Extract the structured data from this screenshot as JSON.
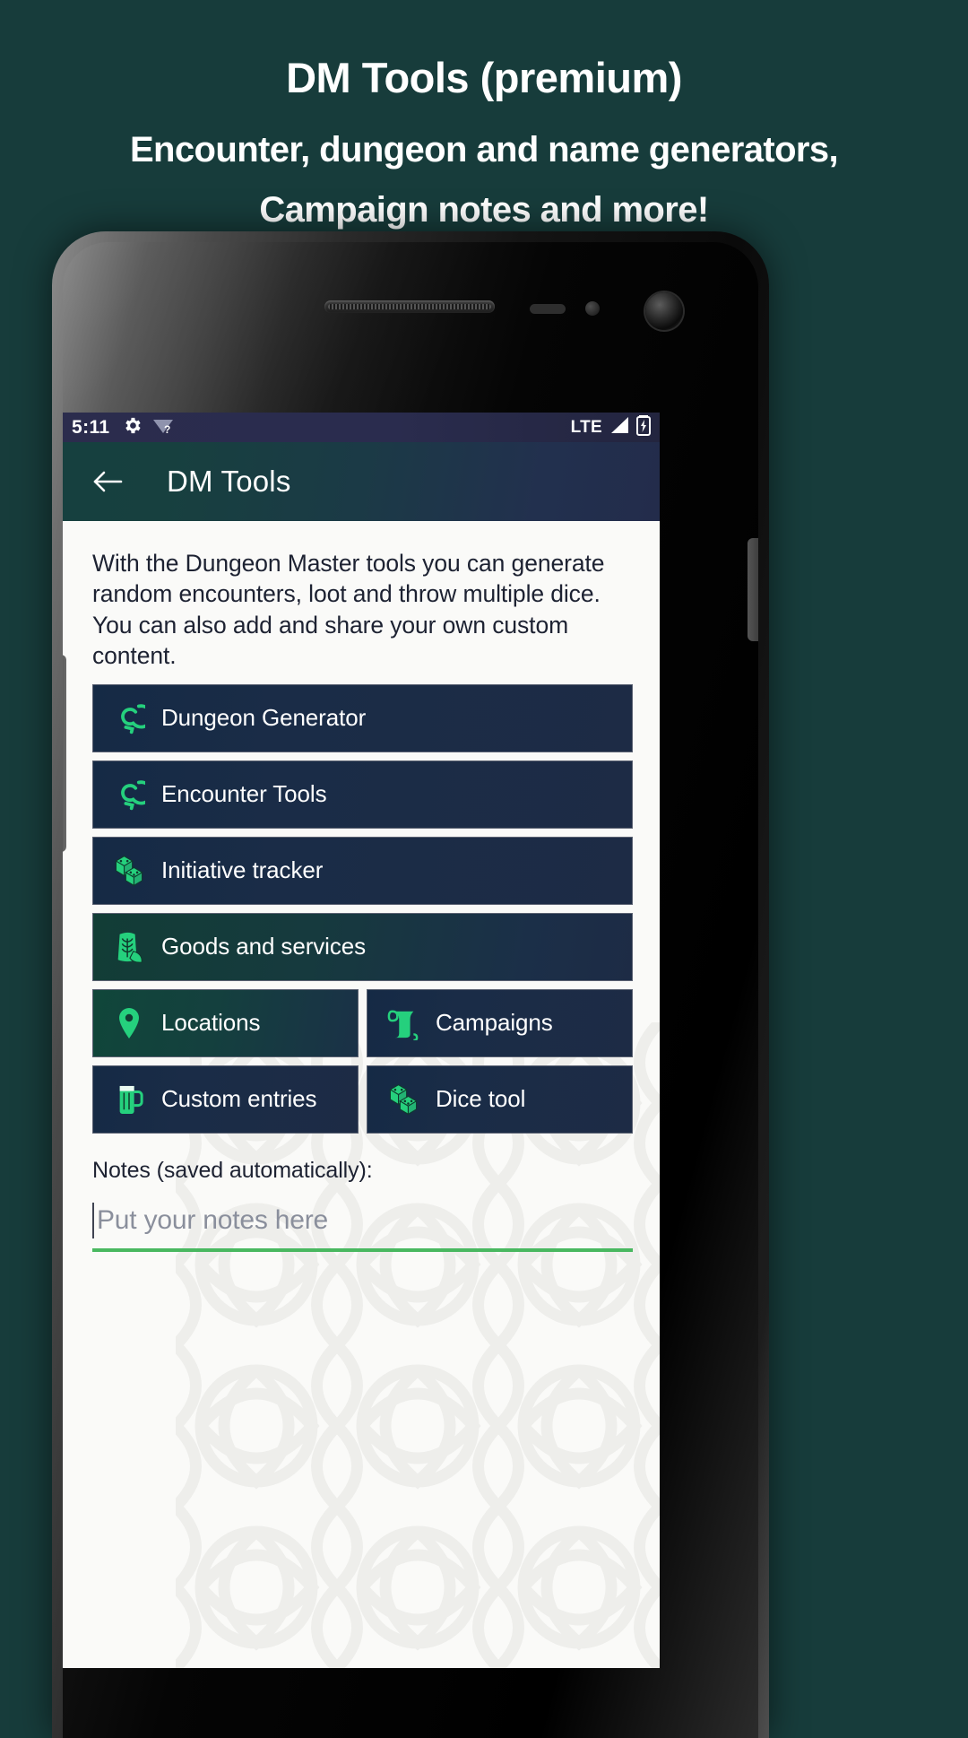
{
  "promo": {
    "title": "DM Tools (premium)",
    "subtitle_line1": "Encounter, dungeon and name generators,",
    "subtitle_line2": "Campaign notes and more!",
    "background_color": "#173c3b",
    "text_color": "#ffffff"
  },
  "statusbar": {
    "time": "5:11",
    "icons": [
      "gear-icon",
      "wifi-unknown-icon"
    ],
    "network_label": "LTE",
    "signal_icon": "signal-bars-icon",
    "battery_icon": "battery-charging-icon",
    "background_color": "#2b2c4d"
  },
  "appbar": {
    "back_icon": "arrow-left-icon",
    "title": "DM Tools",
    "gradient_from": "#16403f",
    "gradient_to": "#232c4b"
  },
  "content": {
    "intro": "With the Dungeon Master tools you can generate random encounters, loot and throw multiple dice. You can also add and share your own custom content.",
    "menu_rows": [
      {
        "buttons": [
          {
            "label": "Dungeon Generator",
            "icon": "spiral-dungeon-icon",
            "style": "navy"
          }
        ]
      },
      {
        "buttons": [
          {
            "label": "Encounter Tools",
            "icon": "spiral-dungeon-icon",
            "style": "navy"
          }
        ]
      },
      {
        "buttons": [
          {
            "label": "Initiative tracker",
            "icon": "dice-pair-icon",
            "style": "navy"
          }
        ]
      },
      {
        "buttons": [
          {
            "label": "Goods and services",
            "icon": "grain-sack-icon",
            "style": "teal"
          }
        ]
      },
      {
        "buttons": [
          {
            "label": "Locations",
            "icon": "map-pin-icon",
            "style": "teal2"
          },
          {
            "label": "Campaigns",
            "icon": "scroll-icon",
            "style": "navy"
          }
        ]
      },
      {
        "buttons": [
          {
            "label": "Custom entries",
            "icon": "beer-mug-icon",
            "style": "navy"
          },
          {
            "label": "Dice tool",
            "icon": "dice-pair-icon",
            "style": "navy"
          }
        ]
      }
    ],
    "notes_label": "Notes (saved automatically):",
    "notes_placeholder": "Put your notes here",
    "notes_value": "",
    "notes_underline_color": "#49b860",
    "accent_green": "#25d07d",
    "surface_color": "#fafaf8"
  }
}
